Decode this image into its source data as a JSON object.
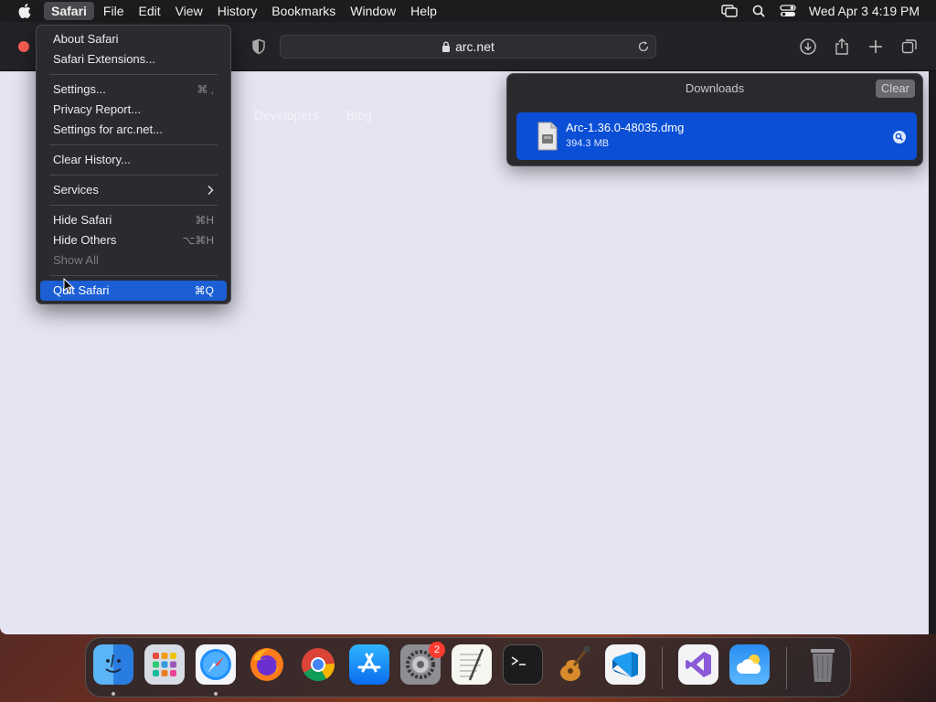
{
  "menubar": {
    "items": [
      "Safari",
      "File",
      "Edit",
      "View",
      "History",
      "Bookmarks",
      "Window",
      "Help"
    ],
    "datetime": "Wed Apr 3  4:19 PM"
  },
  "toolbar": {
    "url": "arc.net"
  },
  "page": {
    "links": [
      "Developers",
      "Blog"
    ]
  },
  "downloads": {
    "title": "Downloads",
    "clear_label": "Clear",
    "items": [
      {
        "name": "Arc-1.36.0-48035.dmg",
        "size": "394.3 MB"
      }
    ]
  },
  "safari_menu": {
    "about": "About Safari",
    "extensions": "Safari Extensions...",
    "settings": "Settings...",
    "settings_sc": "⌘ ,",
    "privacy": "Privacy Report...",
    "settings_for": "Settings for arc.net...",
    "clear_history": "Clear History...",
    "services": "Services",
    "hide": "Hide Safari",
    "hide_sc": "⌘H",
    "hide_others": "Hide Others",
    "hide_others_sc": "⌥⌘H",
    "show_all": "Show All",
    "quit": "Quit Safari",
    "quit_sc": "⌘Q"
  },
  "dock": {
    "apps": [
      "finder",
      "launchpad",
      "safari",
      "firefox",
      "chrome",
      "app-store",
      "system-settings",
      "textedit",
      "terminal",
      "garageband",
      "vscode",
      "visual-studio",
      "weather",
      "trash"
    ],
    "settings_badge": "2"
  }
}
